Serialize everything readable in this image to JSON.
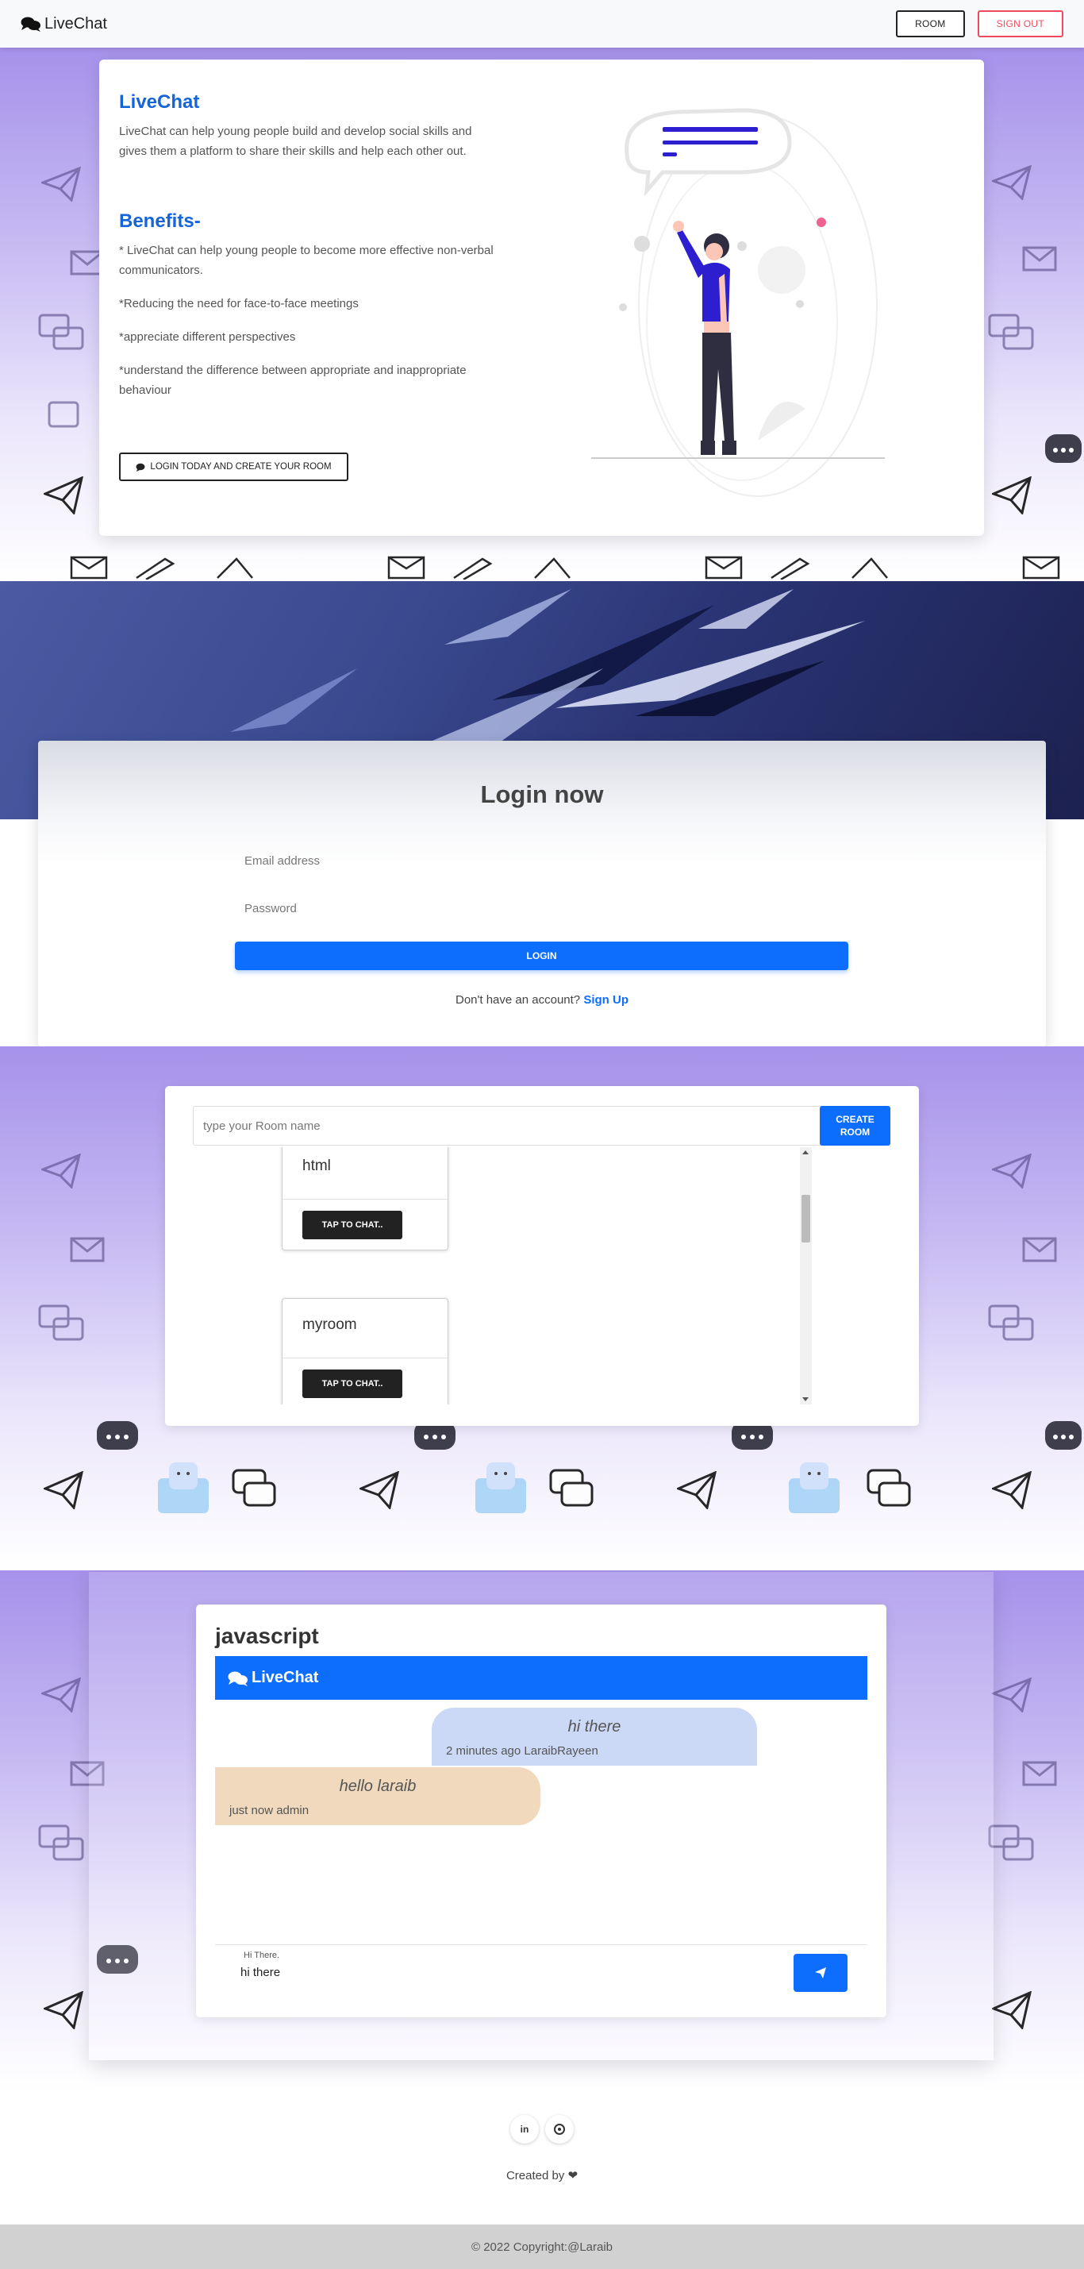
{
  "navbar": {
    "brand": "LiveChat",
    "room_label": "ROOM",
    "signout_label": "SIGN OUT"
  },
  "hero": {
    "title": "LiveChat",
    "description": "LiveChat can help young people build and develop social skills and gives them a platform to share their skills and help each other out.",
    "benefits_title": "Benefits-",
    "benefits": [
      "* LiveChat can help young people to become more effective non-verbal communicators.",
      "*Reducing the need for face-to-face meetings",
      "*appreciate different perspectives",
      "*understand the difference between appropriate and inappropriate behaviour"
    ],
    "cta_label": "LOGIN TODAY AND CREATE YOUR ROOM"
  },
  "login": {
    "title": "Login now",
    "email_placeholder": "Email address",
    "password_placeholder": "Password",
    "button_label": "LOGIN",
    "signup_prompt": "Don't have an account?",
    "signup_link": "Sign Up"
  },
  "rooms": {
    "input_placeholder": "type your Room name",
    "create_label_line1": "CREATE",
    "create_label_line2": "ROOM",
    "items": [
      {
        "name": "html",
        "button": "TAP TO CHAT.."
      },
      {
        "name": "myroom",
        "button": "TAP TO CHAT.."
      }
    ]
  },
  "chat": {
    "room_title": "javascript",
    "header_brand": "LiveChat",
    "messages": [
      {
        "text": "hi there",
        "meta": "2 minutes ago LaraibRayeen",
        "from": "me"
      },
      {
        "text": "hello laraib",
        "meta": "just now admin",
        "from": "other"
      }
    ],
    "input_label": "Hi There.",
    "input_value": "hi there"
  },
  "footer": {
    "linkedin": "in",
    "created_by": "Created by",
    "copyright": "© 2022 Copyright:@Laraib"
  },
  "colors": {
    "primary": "#0d6efd",
    "hero_accent": "#1564d8",
    "signout": "#ef4a5d",
    "me_bubble": "#cbd9f7",
    "other_bubble": "#f0d9bc"
  }
}
